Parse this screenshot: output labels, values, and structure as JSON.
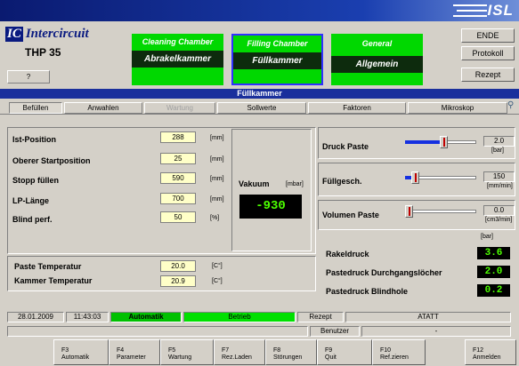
{
  "header": {
    "logo_mark": "IC",
    "logo_text": "Intercircuit",
    "brand": "ISL",
    "model": "THP 35",
    "help_button": "?",
    "modules": [
      {
        "top": "Cleaning Chamber",
        "bottom": "Abrakelkammer",
        "selected": false
      },
      {
        "top": "Filling Chamber",
        "bottom": "Füllkammer",
        "selected": true
      },
      {
        "top": "General",
        "bottom": "Allgemein",
        "selected": false
      }
    ],
    "side_buttons": [
      "ENDE",
      "Protokoll",
      "Rezept"
    ]
  },
  "window_title": "Füllkammer",
  "toolbar": [
    {
      "label": "Befüllen",
      "state": "active"
    },
    {
      "label": "Anwahlen",
      "state": "normal"
    },
    {
      "label": "Wartung",
      "state": "disabled"
    },
    {
      "label": "Sollwerte",
      "state": "normal"
    },
    {
      "label": "Faktoren",
      "state": "normal"
    },
    {
      "label": "Mikroskop",
      "state": "normal"
    }
  ],
  "positions": [
    {
      "label": "Ist-Position",
      "value": "288",
      "unit": "[mm]"
    },
    {
      "label": "Oberer Startposition",
      "value": "25",
      "unit": "[mm]"
    },
    {
      "label": "Stopp füllen",
      "value": "590",
      "unit": "[mm]"
    },
    {
      "label": "LP-Länge",
      "value": "700",
      "unit": "[mm]"
    },
    {
      "label": "Blind perf.",
      "value": "50",
      "unit": "[%]"
    }
  ],
  "vakuum": {
    "label": "Vakuum",
    "unit": "[mbar]",
    "value": "-930"
  },
  "temperatures": [
    {
      "label": "Paste Temperatur",
      "value": "20.0",
      "unit": "[C°]"
    },
    {
      "label": "Kammer Temperatur",
      "value": "20.9",
      "unit": "[C°]"
    }
  ],
  "sliders": [
    {
      "label": "Druck Paste",
      "value": "2.0",
      "unit": "[bar]",
      "level": 0.55
    },
    {
      "label": "Füllgesch.",
      "value": "150",
      "unit": "[mm/min]",
      "level": 0.1
    },
    {
      "label": "Volumen Paste",
      "value": "0.0",
      "unit": "[cm3/min]",
      "level": 0.0
    }
  ],
  "pressures": {
    "unit": "[bar]",
    "items": [
      {
        "label": "Rakeldruck",
        "value": "3.6"
      },
      {
        "label": "Pastedruck Durchgangslöcher",
        "value": "2.0"
      },
      {
        "label": "Pastedruck Blindhole",
        "value": "0.2"
      }
    ]
  },
  "status": {
    "date": "28.01.2009",
    "time": "11:43:03",
    "mode": "Automatik",
    "state": "Betrieb",
    "recipe_label": "Rezept",
    "recipe_value": "ATATT",
    "user_label": "Benutzer",
    "user_value": "-"
  },
  "fkeys": [
    {
      "key": "F3",
      "label": "Automatik"
    },
    {
      "key": "F4",
      "label": "Parameter"
    },
    {
      "key": "F5",
      "label": "Wartung"
    },
    {
      "key": "F7",
      "label": "Rez.Laden"
    },
    {
      "key": "F8",
      "label": "Störungen"
    },
    {
      "key": "F9",
      "label": "Quit"
    },
    {
      "key": "F10",
      "label": "Ref.zieren"
    },
    {
      "key": "F12",
      "label": "Anmelden"
    }
  ],
  "colors": {
    "green_button": "#00d800",
    "dark_label": "#0d2b0d",
    "title_blue": "#1a2f9c",
    "value_yellow": "#ffffc8",
    "readout_green": "#4cff00"
  }
}
